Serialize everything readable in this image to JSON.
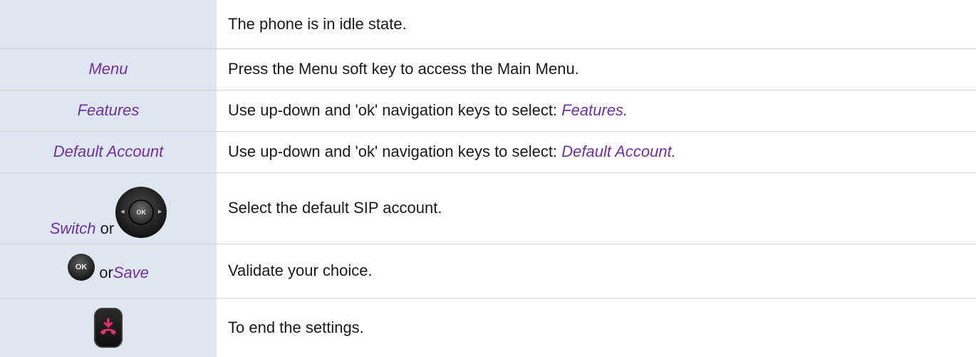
{
  "rows": [
    {
      "left": "",
      "right": "The phone is in idle state."
    },
    {
      "left": "Menu",
      "right": "Press the Menu soft key to access the Main Menu."
    },
    {
      "left": "Features",
      "right_prefix": "Use up-down and 'ok' navigation keys to select: ",
      "right_italic": "Features."
    },
    {
      "left": "Default Account",
      "right_prefix": "Use up-down and 'ok' navigation keys to select: ",
      "right_italic": "Default Account."
    },
    {
      "left_italic": "Switch",
      "left_conj": "or",
      "right": "Select the default SIP account."
    },
    {
      "left_conj": "or",
      "left_italic": "Save",
      "right": "Validate your choice."
    },
    {
      "right": "To end the settings."
    }
  ],
  "icons": {
    "navpad_label": "OK",
    "ok_label": "OK",
    "navpad_icon": "navigation-pad-icon",
    "ok_icon": "ok-button-icon",
    "end_icon": "end-call-key-icon"
  },
  "colors": {
    "left_background": "#dde6f1",
    "italic_text": "#7030a0",
    "end_call_red": "#e8306a"
  }
}
